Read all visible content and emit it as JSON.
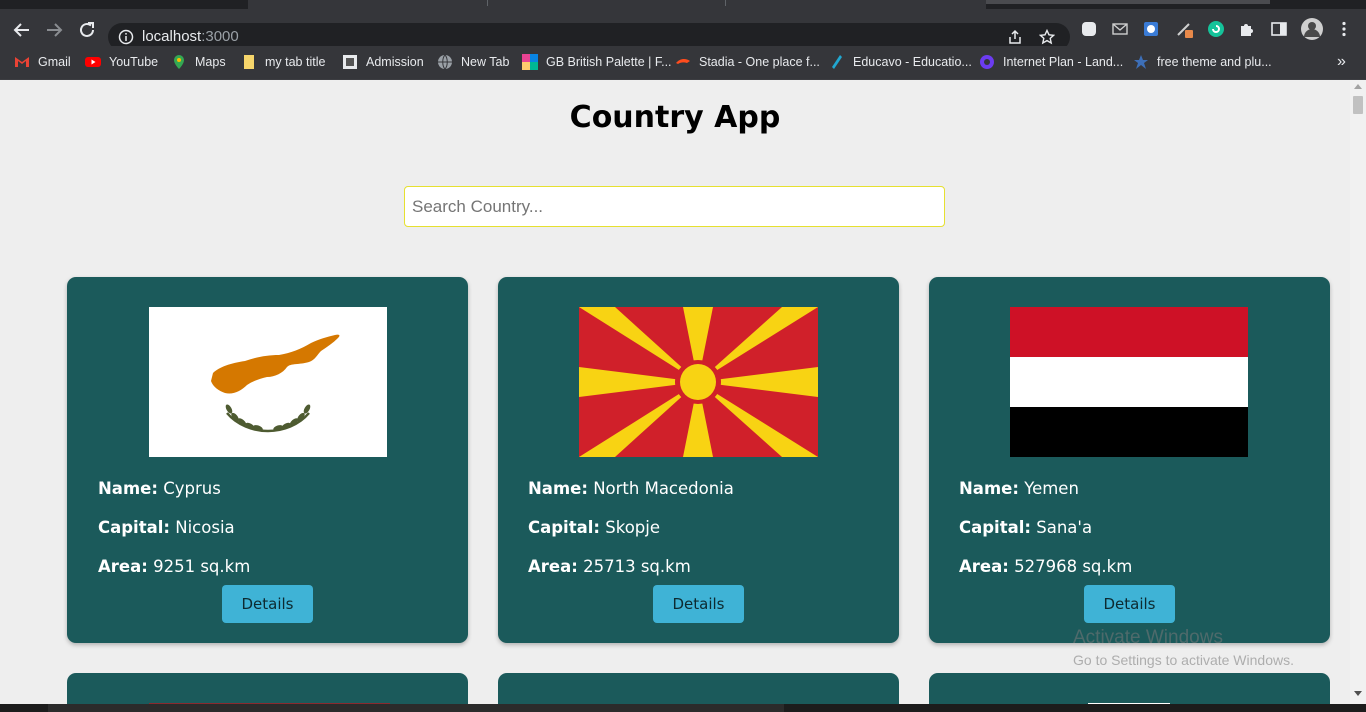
{
  "browser": {
    "url_host": "localhost",
    "url_port": ":3000",
    "bookmarks": [
      {
        "label": "Gmail",
        "icon": "gmail-icon"
      },
      {
        "label": "YouTube",
        "icon": "youtube-icon"
      },
      {
        "label": "Maps",
        "icon": "maps-icon"
      },
      {
        "label": "my tab title",
        "icon": "bookmark-page-icon"
      },
      {
        "label": "Admission",
        "icon": "admission-icon"
      },
      {
        "label": "New Tab",
        "icon": "globe-icon"
      },
      {
        "label": "GB British Palette | F...",
        "icon": "palette-icon"
      },
      {
        "label": "Stadia - One place f...",
        "icon": "stadia-icon"
      },
      {
        "label": "Educavo - Educatio...",
        "icon": "educavo-icon"
      },
      {
        "label": "Internet Plan - Land...",
        "icon": "internet-plan-icon"
      },
      {
        "label": "free theme and plu...",
        "icon": "theme-icon"
      }
    ],
    "overflow_label": "»"
  },
  "app": {
    "title": "Country App",
    "search_placeholder": "Search Country...",
    "labels": {
      "name": "Name:",
      "capital": "Capital:",
      "area": "Area:"
    },
    "details_label": "Details",
    "area_unit": "sq.km",
    "countries": [
      {
        "name": "Cyprus",
        "capital": "Nicosia",
        "area": "9251 sq.km",
        "flag": "cyprus-flag"
      },
      {
        "name": "North Macedonia",
        "capital": "Skopje",
        "area": "25713 sq.km",
        "flag": "north-macedonia-flag"
      },
      {
        "name": "Yemen",
        "capital": "Sana'a",
        "area": "527968 sq.km",
        "flag": "yemen-flag"
      }
    ]
  },
  "watermark": {
    "title": "Activate Windows",
    "subtitle": "Go to Settings to activate Windows."
  },
  "colors": {
    "card_bg": "#1b5a5b",
    "details_button": "#3fb3d6",
    "page_bg": "#eeeeee",
    "search_border": "#e6e030"
  }
}
